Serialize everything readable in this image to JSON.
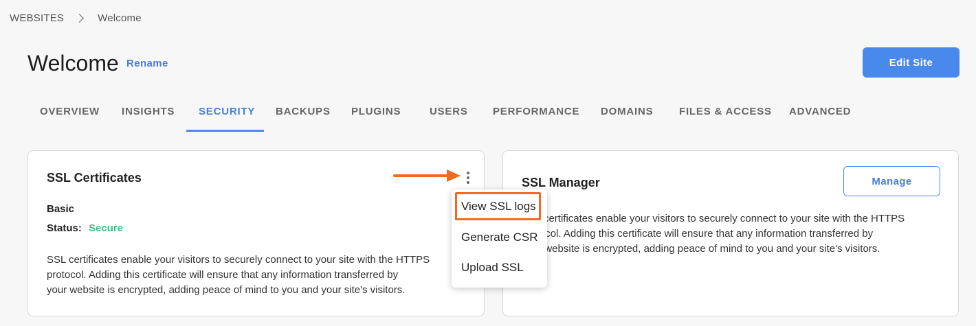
{
  "breadcrumb": {
    "root": "WEBSITES",
    "current": "Welcome"
  },
  "header": {
    "title": "Welcome",
    "rename_label": "Rename",
    "edit_site_label": "Edit Site"
  },
  "tabs": [
    {
      "label": "OVERVIEW"
    },
    {
      "label": "INSIGHTS"
    },
    {
      "label": "SECURITY",
      "active": true
    },
    {
      "label": "BACKUPS"
    },
    {
      "label": "PLUGINS"
    },
    {
      "label": "USERS"
    },
    {
      "label": "PERFORMANCE"
    },
    {
      "label": "DOMAINS"
    },
    {
      "label": "FILES & ACCESS"
    },
    {
      "label": "ADVANCED"
    }
  ],
  "ssl_card": {
    "title": "SSL Certificates",
    "plan": "Basic",
    "status_label": "Status:",
    "status_value": "Secure",
    "description": [
      "SSL certificates enable your visitors to securely connect to your site with the HTTPS",
      "protocol. Adding this certificate will ensure that any information transferred by",
      "your website is encrypted, adding peace of mind to you and your site's visitors."
    ]
  },
  "ssl_manager": {
    "title": "SSL Manager",
    "manage_label": "Manage",
    "description": [
      "SSL certificates enable your visitors to securely connect to your site with the HTTPS",
      "protocol. Adding this certificate will ensure that any information transferred by",
      "your website is encrypted, adding peace of mind to you and your site's visitors."
    ]
  },
  "dropdown_menu": {
    "items": [
      "View SSL logs",
      "Generate CSR",
      "Upload SSL"
    ],
    "highlighted_item": "View SSL logs"
  },
  "colors": {
    "accent": "#4a89ec",
    "secure": "#3fbf8a",
    "annotation": "#f06a1f"
  },
  "icons": {
    "breadcrumb_separator": "chevron-right-icon",
    "menu": "kebab-menu-icon",
    "annotation": "arrow-right-icon"
  }
}
